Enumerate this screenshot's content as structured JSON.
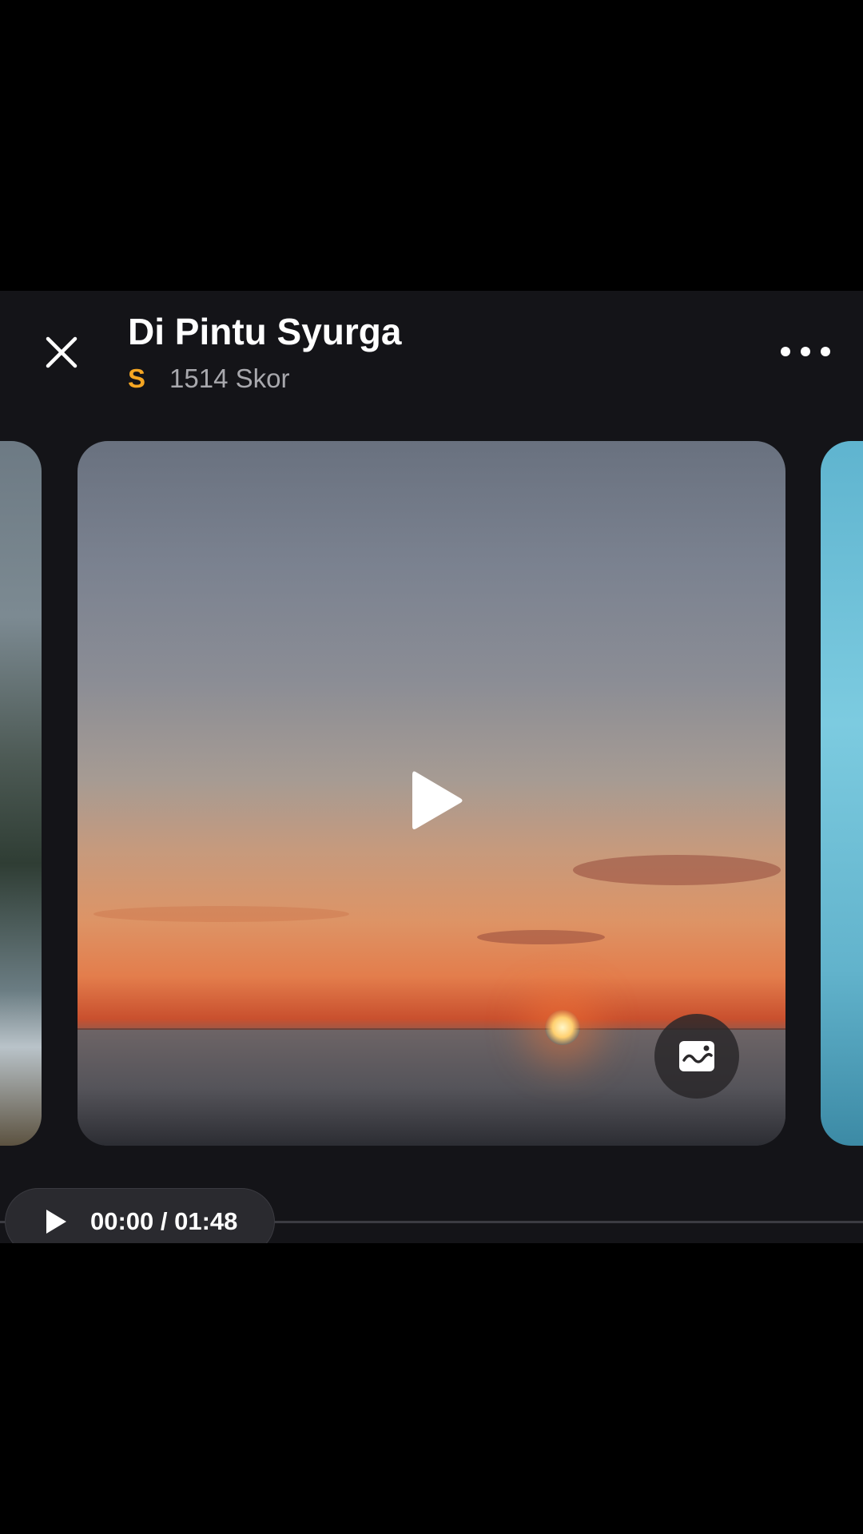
{
  "header": {
    "title": "Di Pintu Syurga",
    "score_badge": "S",
    "score_text": "1514 Skor",
    "badge_color": "#f5a623"
  },
  "icons": {
    "close": "close-icon",
    "more": "more-dots-icon",
    "play": "play-icon",
    "wallpaper": "wallpaper-icon"
  },
  "player": {
    "time": "00:00 / 01:48",
    "progress": 0
  }
}
